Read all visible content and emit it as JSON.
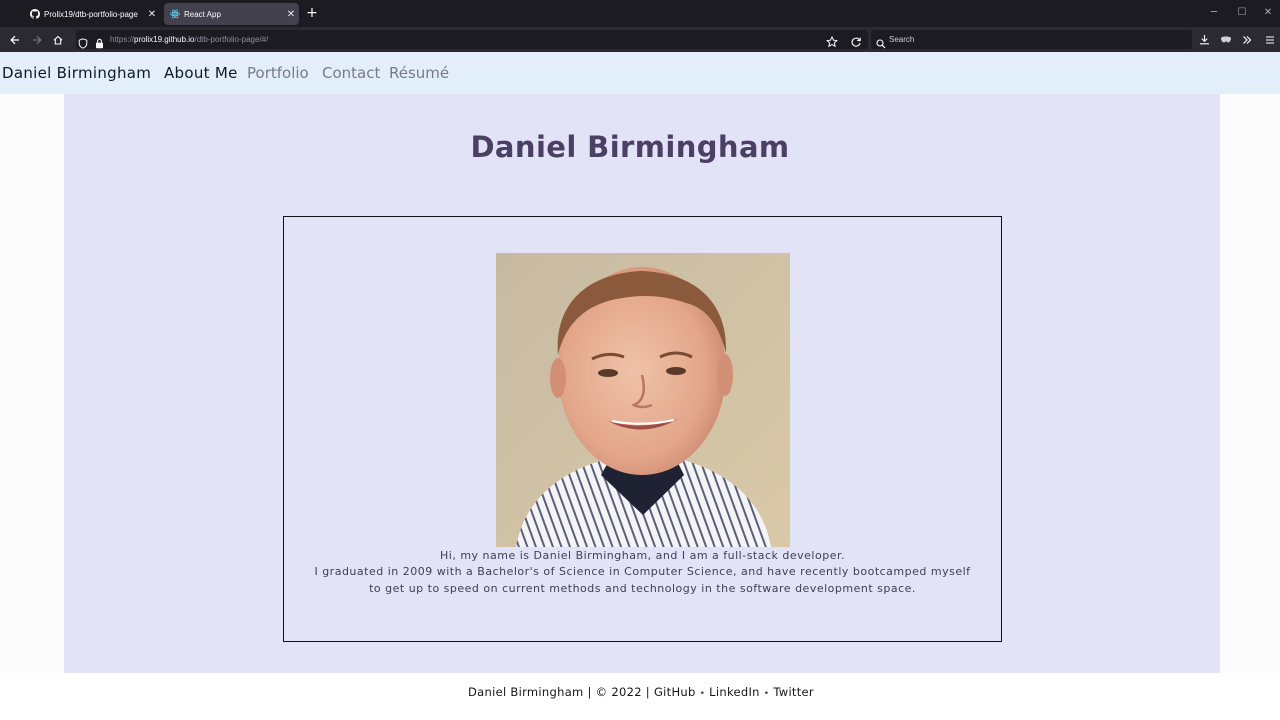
{
  "browser": {
    "tabs": [
      {
        "title": "Prolix19/dtb-portfolio-page",
        "icon": "github-icon",
        "active": false
      },
      {
        "title": "React App",
        "icon": "react-icon",
        "active": true
      }
    ],
    "url_prefix": "https://",
    "url_host": "prolix19.github.io",
    "url_path": "/dtb-portfolio-page/#/",
    "search_placeholder": "Search"
  },
  "nav": {
    "brand": "Daniel Birmingham",
    "links": [
      "About Me",
      "Portfolio",
      "Contact",
      "Résumé"
    ],
    "active": "About Me",
    "background": "#e2effb"
  },
  "main": {
    "title": "Daniel Birmingham",
    "photo_alt": "Portrait of Daniel Birmingham",
    "bio_lines": [
      "Hi, my name is Daniel Birmingham, and I am a full-stack developer.",
      "I graduated in 2009 with a Bachelor's of Science in Computer Science, and have recently bootcamped myself",
      "to get up to speed on current methods and technology in the software development space."
    ],
    "background": "#e3e3f7"
  },
  "footer": {
    "copyright": "Daniel Birmingham | © 2022 |",
    "links": [
      "GitHub",
      "LinkedIn",
      "Twitter"
    ],
    "separator": "•"
  }
}
